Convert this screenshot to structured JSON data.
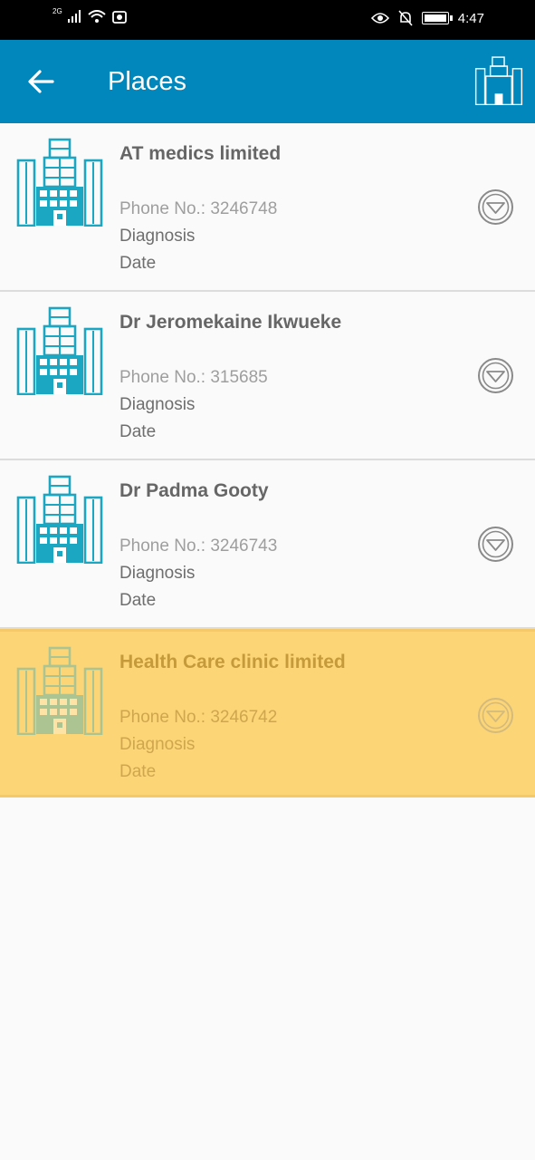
{
  "status_bar": {
    "network": "2G",
    "time": "4:47"
  },
  "app_bar": {
    "title": "Places"
  },
  "places": [
    {
      "name": "AT medics limited",
      "phone": "Phone No.: 3246748",
      "diagnosis": "Diagnosis",
      "date": "Date",
      "highlighted": false
    },
    {
      "name": "Dr Jeromekaine Ikwueke",
      "phone": "Phone No.: 315685",
      "diagnosis": "Diagnosis",
      "date": "Date",
      "highlighted": false
    },
    {
      "name": "Dr Padma Gooty",
      "phone": "Phone No.: 3246743",
      "diagnosis": "Diagnosis",
      "date": "Date",
      "highlighted": false
    },
    {
      "name": "Health Care clinic limited",
      "phone": "Phone No.: 3246742",
      "diagnosis": "Diagnosis",
      "date": "Date",
      "highlighted": true
    }
  ],
  "colors": {
    "app_bar": "#0187bb",
    "icon_teal": "#1ba6c1",
    "highlight": "#fcd577",
    "status_bar": "#000000"
  },
  "icons": {
    "back": "arrow-left-icon",
    "header": "building-icon",
    "item": "building-icon",
    "expand": "chevron-down-circle-icon"
  }
}
